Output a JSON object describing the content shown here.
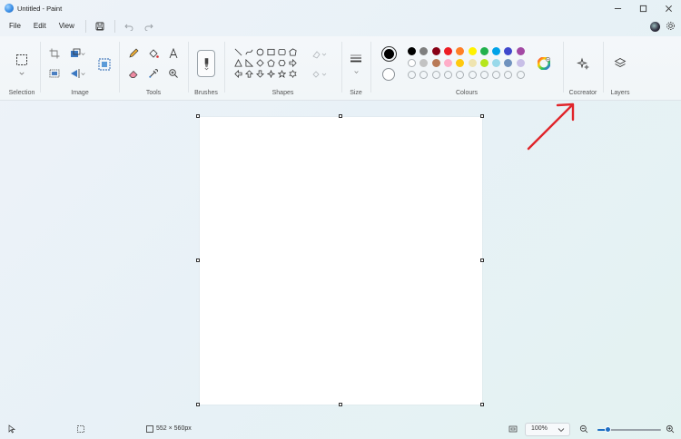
{
  "window": {
    "title": "Untitled - Paint"
  },
  "menu": {
    "items": [
      "File",
      "Edit",
      "View"
    ]
  },
  "ribbon": {
    "groups": {
      "selection": "Selection",
      "image": "Image",
      "tools": "Tools",
      "brushes": "Brushes",
      "shapes": "Shapes",
      "size": "Size",
      "colours": "Colours",
      "cocreator": "Cocreator",
      "layers": "Layers"
    },
    "colours": {
      "primary": "#000000",
      "secondary": "#ffffff",
      "row1": [
        "#000000",
        "#7f7f7f",
        "#880015",
        "#ed1c24",
        "#ff7f27",
        "#fff200",
        "#22b14c",
        "#00a2e8",
        "#3f48cc",
        "#a349a4"
      ],
      "row2": [
        "#ffffff",
        "#c3c3c3",
        "#b97a57",
        "#ffaec9",
        "#ffc90e",
        "#efe4b0",
        "#b5e61d",
        "#99d9ea",
        "#7092be",
        "#c8bfe7"
      ],
      "row3_empty_count": 10
    }
  },
  "status": {
    "canvas_size": "552 × 560px",
    "zoom": "100%",
    "zoom_level": 0.17
  },
  "colors": {
    "accent": "#1f6fc4",
    "annotation_arrow": "#e0242a"
  }
}
